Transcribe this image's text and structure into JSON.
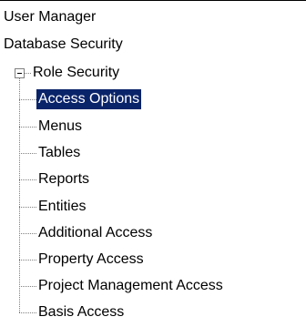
{
  "tree": {
    "roots": [
      {
        "label": "User Manager"
      },
      {
        "label": "Database Security"
      }
    ],
    "role_security": {
      "label": "Role Security",
      "expanded": true,
      "children": [
        {
          "label": "Access Options",
          "selected": true
        },
        {
          "label": "Menus"
        },
        {
          "label": "Tables"
        },
        {
          "label": "Reports"
        },
        {
          "label": "Entities"
        },
        {
          "label": "Additional Access"
        },
        {
          "label": "Property Access"
        },
        {
          "label": "Project Management Access"
        },
        {
          "label": "Basis Access"
        }
      ]
    }
  },
  "colors": {
    "selection_background": "#0a246a",
    "selection_text": "#ffffff",
    "guide_lines": "#808080"
  }
}
